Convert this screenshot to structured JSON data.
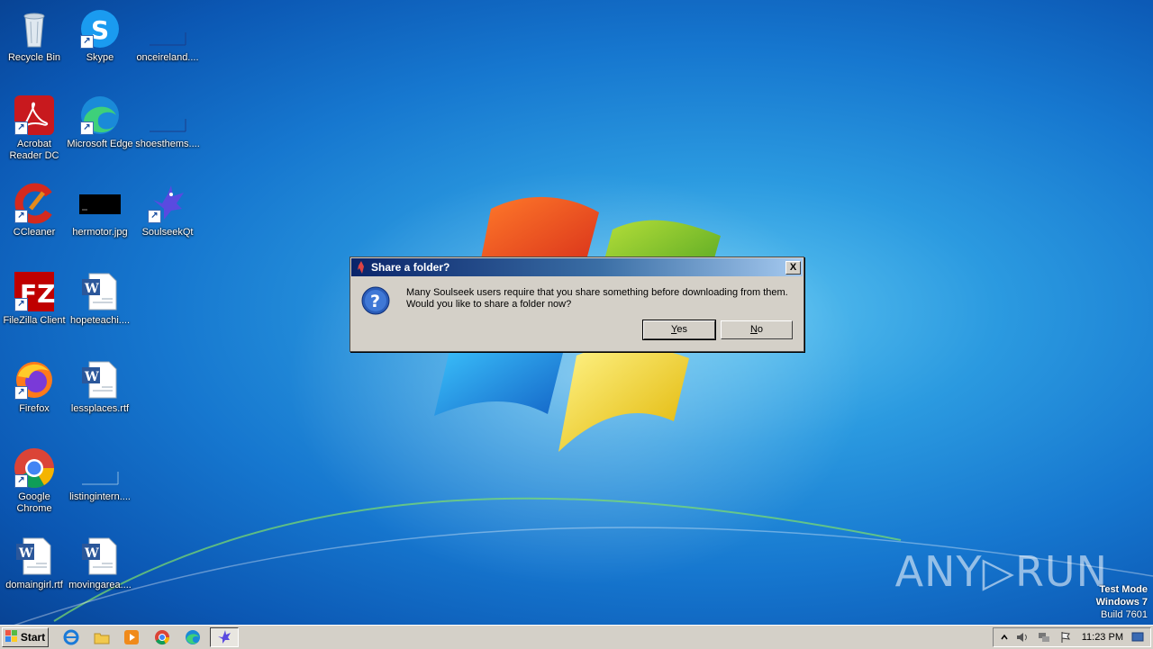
{
  "desktop": {
    "icons": [
      {
        "label": "Recycle Bin",
        "icon": "recycle-bin-icon"
      },
      {
        "label": "Skype",
        "icon": "skype-icon"
      },
      {
        "label": "onceireland....",
        "icon": "file-icon"
      },
      {
        "label": "Acrobat Reader DC",
        "icon": "acrobat-icon"
      },
      {
        "label": "Microsoft Edge",
        "icon": "edge-icon"
      },
      {
        "label": "shoesthems....",
        "icon": "file-icon"
      },
      {
        "label": "CCleaner",
        "icon": "ccleaner-icon"
      },
      {
        "label": "hermotor.jpg",
        "icon": "image-icon"
      },
      {
        "label": "SoulseekQt",
        "icon": "soulseek-icon"
      },
      {
        "label": "FileZilla Client",
        "icon": "filezilla-icon"
      },
      {
        "label": "hopeteachi....",
        "icon": "word-doc-icon"
      },
      {
        "label": "Firefox",
        "icon": "firefox-icon"
      },
      {
        "label": "lessplaces.rtf",
        "icon": "word-doc-icon"
      },
      {
        "label": "Google Chrome",
        "icon": "chrome-icon"
      },
      {
        "label": "listingintern....",
        "icon": "file-icon"
      },
      {
        "label": "domaingirl.rtf",
        "icon": "word-doc-icon"
      },
      {
        "label": "movingarea....",
        "icon": "word-doc-icon"
      }
    ]
  },
  "dialog": {
    "title": "Share a folder?",
    "close_label": "X",
    "message_line1": "Many Soulseek users require that you share something before downloading from them.",
    "message_line2": "Would you like to share a folder now?",
    "yes_label": "Yes",
    "no_label": "No"
  },
  "taskbar": {
    "start_label": "Start",
    "clock": "11:23 PM"
  },
  "watermark": "ANY▷RUN",
  "test_mode": {
    "line1": "Test Mode",
    "line2": "Windows 7",
    "line3": "Build 7601"
  },
  "colors": {
    "title_gradient_start": "#0a246a",
    "title_gradient_end": "#a6caf0",
    "dialog_bg": "#d4d0c8"
  }
}
